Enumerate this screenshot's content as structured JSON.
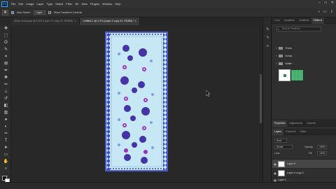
{
  "menu": {
    "logo": "Ps",
    "items": [
      "File",
      "Edit",
      "Image",
      "Layer",
      "Type",
      "Select",
      "Filter",
      "3D",
      "View",
      "Plugins",
      "Window",
      "Help"
    ]
  },
  "options": {
    "auto_select": "Auto-Select:",
    "layer_dd": "Layer",
    "transform": "Show Transform Controls"
  },
  "tabs": [
    {
      "label": "Silver clmns.psd @ 8.3% (Layer 72 copy 23, RGB/8) *  ×"
    },
    {
      "label": "Untitled-1 @ 2.2% (Layer 2 copy 22, RGB/8) *  ×"
    }
  ],
  "panels": {
    "top_tabs": [
      "Color",
      "Swatches",
      "Gradients",
      "Patterns"
    ],
    "search_placeholder": "Search Patterns",
    "folders": [
      "Trees",
      "Grass",
      "Water"
    ],
    "bottom_tabs": [
      "Properties",
      "Adjustments",
      "Libraries"
    ],
    "layer_tabs": [
      "Layers",
      "Channels",
      "Paths"
    ],
    "kind_dd": "Kind",
    "blend_dd": "Divide",
    "opacity_label": "Opacity:",
    "opacity_value": "100%",
    "lock_label": "Lock:",
    "fill_label": "Fill:",
    "fill_value": "100%",
    "layers": [
      "Layer 5",
      "Layer 4 copy 2",
      "Layer 4"
    ]
  },
  "colors": {
    "doc_bg": "#c6e8f4",
    "doc_border": "#4a58c9",
    "accent": "#1f6fd6"
  }
}
